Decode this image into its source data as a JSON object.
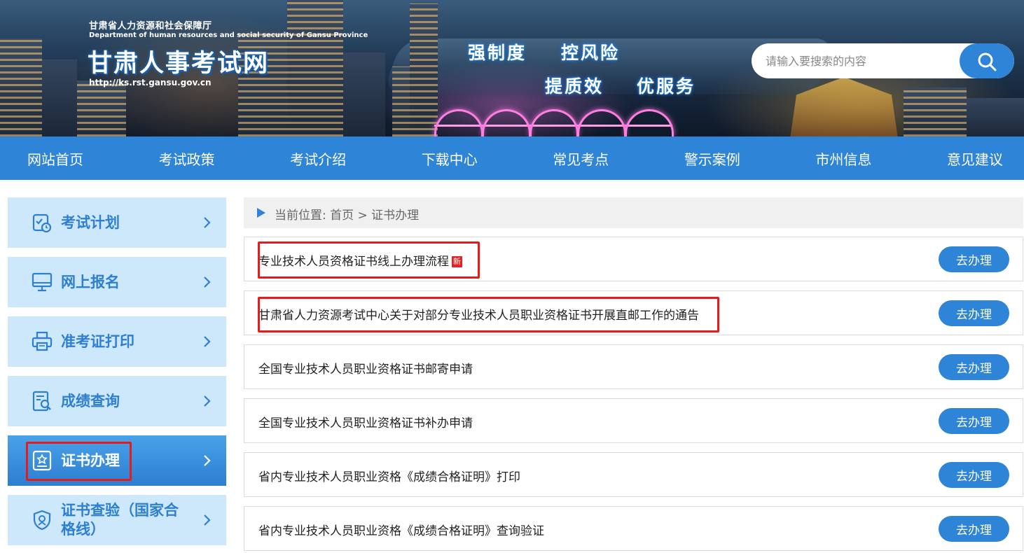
{
  "header": {
    "org_cn": "甘肃省人力资源和社会保障厅",
    "org_en": "Department of human resources and social security of Gansu Province",
    "site_title": "甘肃人事考试网",
    "site_url": "http://ks.rst.gansu.gov.cn",
    "slogans": [
      "强制度",
      "控风险",
      "提质效",
      "优服务"
    ],
    "search": {
      "placeholder": "请输入要搜索的内容",
      "icon": "search-icon"
    }
  },
  "nav": {
    "items": [
      "网站首页",
      "考试政策",
      "考试介绍",
      "下载中心",
      "常见考点",
      "警示案例",
      "市州信息",
      "意见建议"
    ]
  },
  "sidebar": {
    "items": [
      {
        "label": "考试计划",
        "icon": "calendar-check-icon",
        "active": false
      },
      {
        "label": "网上报名",
        "icon": "monitor-icon",
        "active": false
      },
      {
        "label": "准考证打印",
        "icon": "printer-icon",
        "active": false
      },
      {
        "label": "成绩查询",
        "icon": "document-search-icon",
        "active": false
      },
      {
        "label": "证书办理",
        "icon": "certificate-icon",
        "active": true
      },
      {
        "label": "证书查验（国家合格线）",
        "icon": "shield-check-icon",
        "active": false
      }
    ]
  },
  "breadcrumb": {
    "text": "当前位置:  首页 > 证书办理"
  },
  "list": {
    "new_badge": "新",
    "button_label": "去办理",
    "items": [
      {
        "title": "专业技术人员资格证书线上办理流程",
        "is_new": true
      },
      {
        "title": "甘肃省人力资源考试中心关于对部分专业技术人员职业资格证书开展直邮工作的通告",
        "is_new": false
      },
      {
        "title": "全国专业技术人员职业资格证书邮寄申请",
        "is_new": false
      },
      {
        "title": "全国专业技术人员职业资格证书补办申请",
        "is_new": false
      },
      {
        "title": "省内专业技术人员职业资格《成绩合格证明》打印",
        "is_new": false
      },
      {
        "title": "省内专业技术人员职业资格《成绩合格证明》查询验证",
        "is_new": false
      }
    ]
  },
  "colors": {
    "primary": "#2e84d6",
    "sidebar_bg": "#cde8fb",
    "highlight": "#e61c1c",
    "badge": "#e52222"
  }
}
